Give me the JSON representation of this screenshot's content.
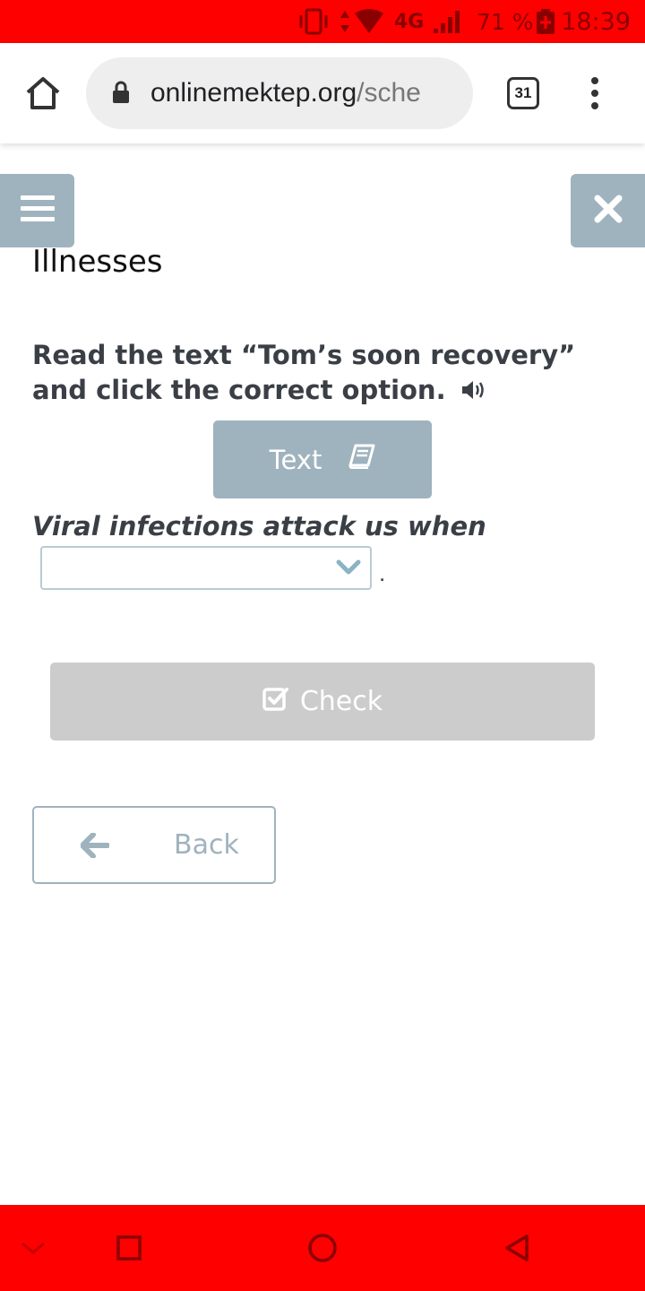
{
  "status_bar": {
    "network": "4G",
    "battery": "71 %",
    "time": "18:39",
    "background": "#ff0000",
    "icons": [
      "vibrate-icon",
      "data-arrows-icon",
      "wifi-icon",
      "signal-icon",
      "battery-icon"
    ]
  },
  "browser": {
    "url_domain": "onlinemektep.org",
    "url_path": "/sche",
    "tab_count": "31",
    "icons": [
      "home-icon",
      "lock-icon",
      "tabs-icon",
      "more-vert-icon"
    ]
  },
  "lesson": {
    "title": "Illnesses",
    "instruction": "Read the text “Tom’s soon recovery” and click the correct option.",
    "text_button_label": "Text",
    "question": "Viral infections attack us when",
    "select_value": "",
    "sentence_end": ".",
    "check_label": "Check",
    "back_label": "Back",
    "accent_color": "#9fb3be",
    "disabled_color": "#cccccc"
  },
  "nav_bar": {
    "background": "#ff0000",
    "icons": [
      "chevron-down-icon",
      "square-icon",
      "circle-icon",
      "triangle-back-icon"
    ]
  }
}
